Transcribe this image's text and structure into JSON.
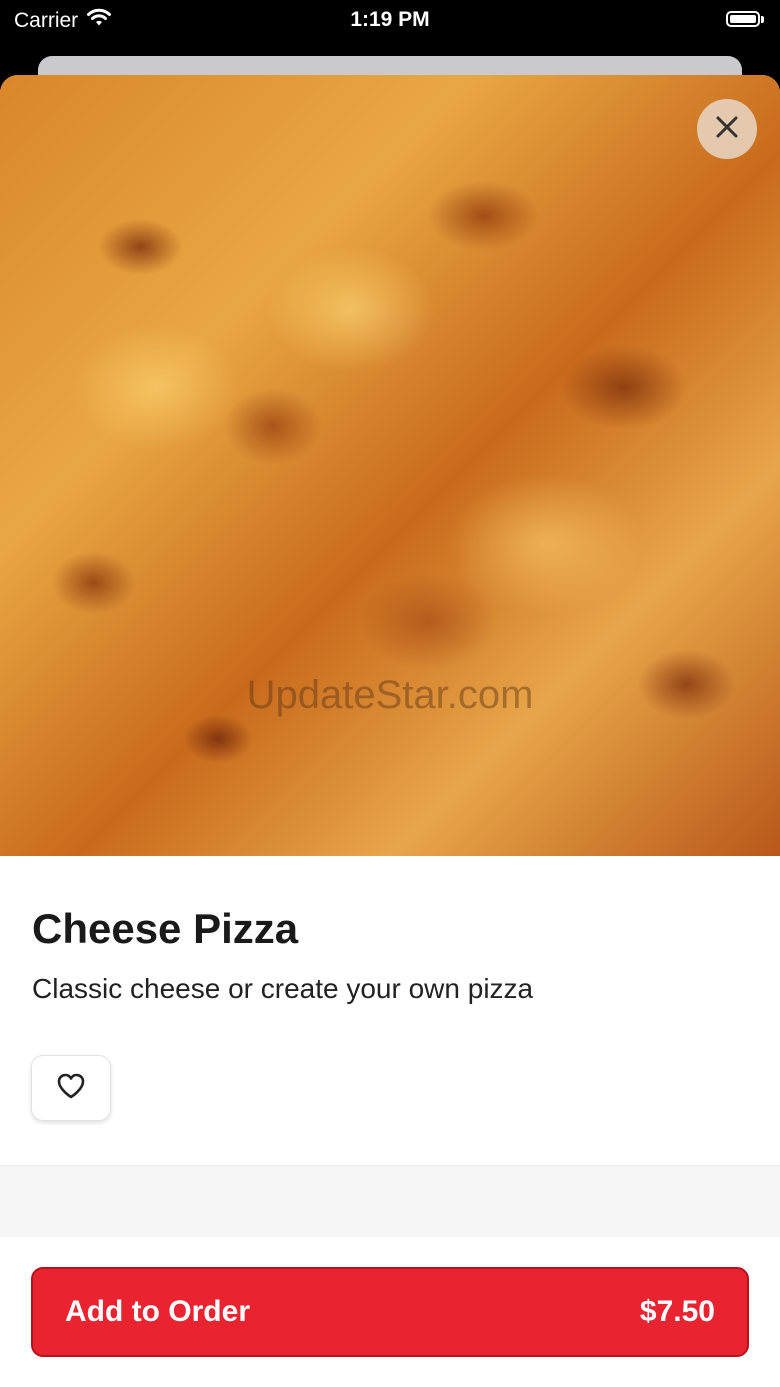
{
  "status_bar": {
    "carrier": "Carrier",
    "time": "1:19 PM"
  },
  "item": {
    "image_watermark": "UpdateStar.com",
    "title": "Cheese Pizza",
    "description": "Classic cheese or create your own pizza"
  },
  "order_button": {
    "label": "Add to Order",
    "price": "$7.50"
  },
  "colors": {
    "accent": "#ea2330",
    "title": "#1a1a1a"
  },
  "icons": [
    "wifi-icon",
    "battery-icon",
    "close-icon",
    "heart-icon"
  ]
}
